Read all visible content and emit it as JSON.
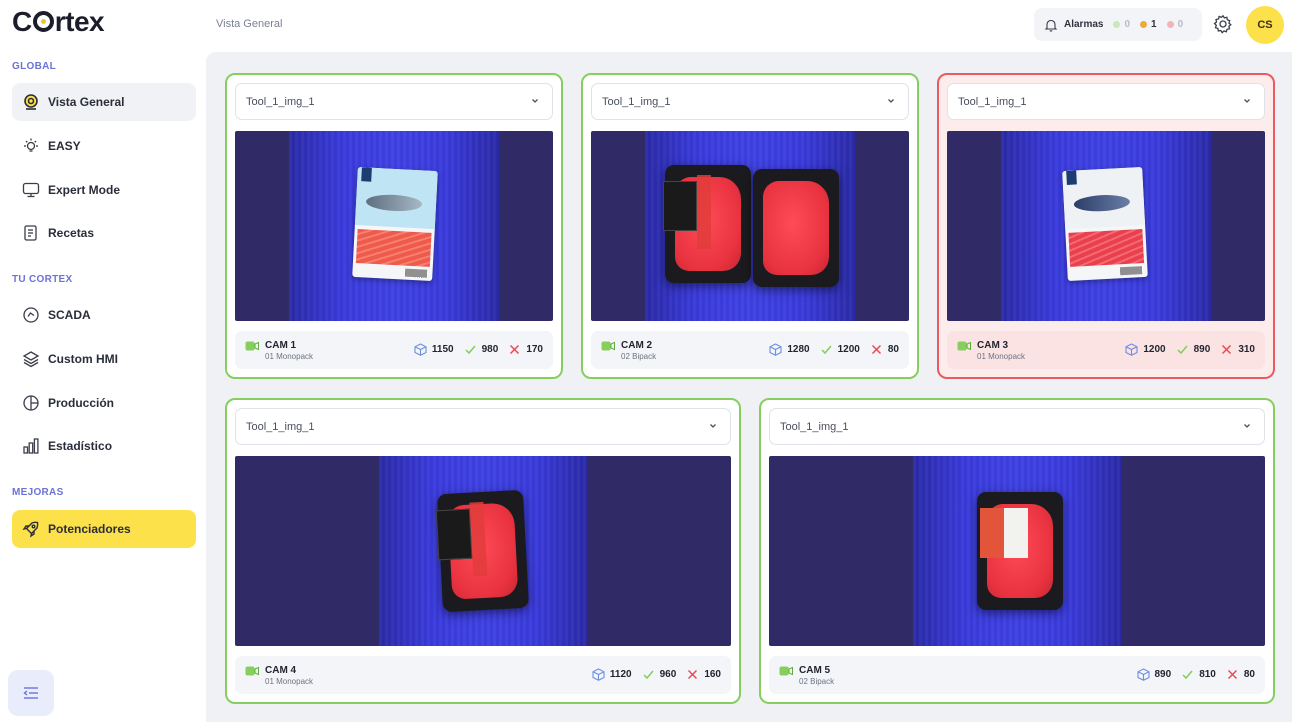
{
  "app": {
    "logo": "Cortex"
  },
  "sidebar": {
    "sections": [
      {
        "title": "GLOBAL"
      },
      {
        "title": "TU CORTEX"
      },
      {
        "title": "MEJORAS"
      }
    ],
    "items": [
      {
        "label": "Vista General",
        "icon": "dashboard-icon",
        "active": true
      },
      {
        "label": "EASY",
        "icon": "bulb-icon"
      },
      {
        "label": "Expert Mode",
        "icon": "monitor-icon"
      },
      {
        "label": "Recetas",
        "icon": "recipe-icon"
      },
      {
        "label": "SCADA",
        "icon": "scada-icon"
      },
      {
        "label": "Custom HMI",
        "icon": "layers-icon"
      },
      {
        "label": "Producción",
        "icon": "pie-icon"
      },
      {
        "label": "Estadístico",
        "icon": "bar-chart-icon"
      },
      {
        "label": "Potenciadores",
        "icon": "rocket-icon",
        "highlight": true
      }
    ]
  },
  "header": {
    "breadcrumb": "Vista General",
    "alarms": {
      "label": "Alarmas",
      "counts": [
        {
          "value": "0",
          "color": "#b8e3a6"
        },
        {
          "value": "1",
          "color": "#f2a93b"
        },
        {
          "value": "0",
          "color": "#f3b4b8"
        }
      ]
    },
    "avatar": "CS"
  },
  "colors": {
    "ok": "#86cf5e",
    "alert": "#eb5a63",
    "accent": "#fde14a"
  },
  "cameras": [
    {
      "tool": "Tool_1_img_1",
      "name": "CAM 1",
      "sub": "01 Monopack",
      "total": "1150",
      "ok": "980",
      "ko": "170",
      "status": "ok"
    },
    {
      "tool": "Tool_1_img_1",
      "name": "CAM 2",
      "sub": "02 Bipack",
      "total": "1280",
      "ok": "1200",
      "ko": "80",
      "status": "ok"
    },
    {
      "tool": "Tool_1_img_1",
      "name": "CAM 3",
      "sub": "01 Monopack",
      "total": "1200",
      "ok": "890",
      "ko": "310",
      "status": "alert"
    },
    {
      "tool": "Tool_1_img_1",
      "name": "CAM 4",
      "sub": "01 Monopack",
      "total": "1120",
      "ok": "960",
      "ko": "160",
      "status": "ok"
    },
    {
      "tool": "Tool_1_img_1",
      "name": "CAM 5",
      "sub": "02 Bipack",
      "total": "890",
      "ok": "810",
      "ko": "80",
      "status": "ok"
    }
  ]
}
